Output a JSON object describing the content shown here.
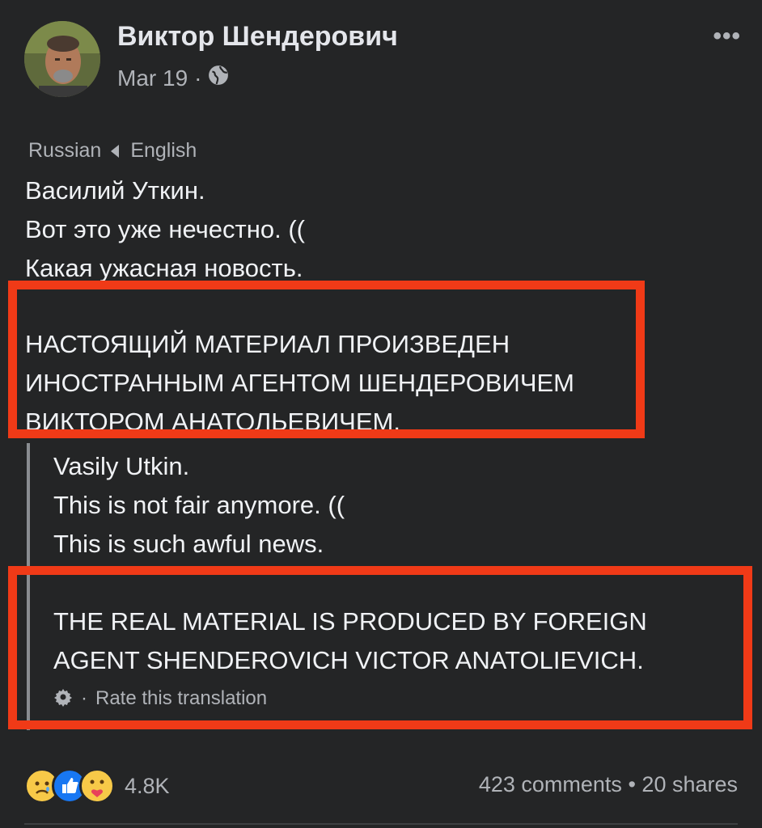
{
  "post": {
    "author": "Виктор Шендерович",
    "date": "Mar 19",
    "meta_dot": "·",
    "audience_icon": "globe-icon",
    "more_icon": "ellipsis-icon"
  },
  "language": {
    "from": "Russian",
    "to": "English"
  },
  "original_text": {
    "line1": "Василий Уткин.",
    "line2": "Вот это уже нечестно. ((",
    "line3": "Какая ужасная новость.",
    "caps1": "НАСТОЯЩИЙ МАТЕРИАЛ ПРОИЗВЕДЕН",
    "caps2": "ИНОСТРАННЫМ АГЕНТОМ ШЕНДЕРОВИЧЕМ",
    "caps3": "ВИКТОРОМ АНАТОЛЬЕВИЧЕМ."
  },
  "translation": {
    "line1": "Vasily Utkin.",
    "line2": "This is not fair anymore. ((",
    "line3": "This is such awful news.",
    "caps1": "THE REAL MATERIAL IS PRODUCED BY FOREIGN",
    "caps2": "AGENT SHENDEROVICH VICTOR ANATOLIEVICH.",
    "rate_label": "Rate this translation",
    "rate_dot": "·"
  },
  "reactions": {
    "icons": [
      "sad-reaction-icon",
      "like-reaction-icon",
      "care-reaction-icon"
    ],
    "count": "4.8K"
  },
  "stats": {
    "comments": "423 comments",
    "dot": "•",
    "shares": "20 shares"
  },
  "colors": {
    "background": "#242526",
    "highlight_border": "#f03a17",
    "like_blue": "#1877f2"
  }
}
